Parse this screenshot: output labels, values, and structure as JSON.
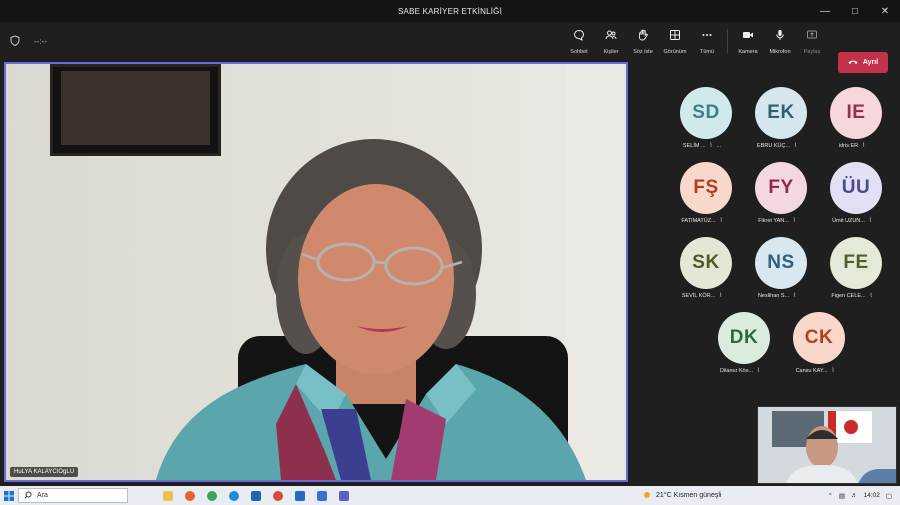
{
  "window": {
    "title": "SABE KARİYER ETKİNLİĞİ",
    "controls": [
      "minimize-icon",
      "maximize-icon",
      "close-icon"
    ]
  },
  "toolbar": {
    "timer": "--:--",
    "items": [
      {
        "label": "Sohbet",
        "icon": "chat-icon"
      },
      {
        "label": "Kişiler",
        "icon": "people-icon"
      },
      {
        "label": "Söz iste",
        "icon": "raise-hand-icon"
      },
      {
        "label": "Görünüm",
        "icon": "view-icon"
      },
      {
        "label": "Tümü",
        "icon": "more-icon"
      },
      {
        "label": "Kamera",
        "icon": "camera-icon"
      },
      {
        "label": "Mikrofon",
        "icon": "microphone-icon"
      },
      {
        "label": "Paylaş",
        "icon": "share-icon"
      }
    ],
    "leave_label": "Ayrıl",
    "leave_color": "#c4314b"
  },
  "main_video": {
    "speaker_name": "HuLYA KALAYCIOgLU",
    "active_border_color": "#6b69d6"
  },
  "participants": [
    {
      "initials": "SD",
      "name": "SELİM ...",
      "bg": "#cfe9ec",
      "fg": "#3d7f86",
      "more": "..."
    },
    {
      "initials": "EK",
      "name": "EBRU KÜÇ...",
      "bg": "#d5e6ef",
      "fg": "#2f5f73"
    },
    {
      "initials": "IE",
      "name": "idris ER",
      "bg": "#f5d7dc",
      "fg": "#9b2c4b"
    },
    {
      "initials": "FŞ",
      "name": "FATIMATÜZ...",
      "bg": "#f8d8cb",
      "fg": "#b23b22"
    },
    {
      "initials": "FY",
      "name": "Fikret YAN...",
      "bg": "#f3d9df",
      "fg": "#8f2a44"
    },
    {
      "initials": "ÜU",
      "name": "Ümit UZUN...",
      "bg": "#e3e0f3",
      "fg": "#4b4a8e"
    },
    {
      "initials": "SK",
      "name": "SEVİL KÖR...",
      "bg": "#e3e8d6",
      "fg": "#4a5a2a"
    },
    {
      "initials": "NS",
      "name": "Neslihan S...",
      "bg": "#d8e7f0",
      "fg": "#2f5f7c"
    },
    {
      "initials": "FE",
      "name": "Figen CELE...",
      "bg": "#e3ead8",
      "fg": "#4e5f2b"
    },
    {
      "initials": "DK",
      "name": "Dilanur Kös...",
      "bg": "#d9ecdd",
      "fg": "#2f6a3f"
    },
    {
      "initials": "CK",
      "name": "Cansu KAY...",
      "bg": "#f9d8cb",
      "fg": "#b73e22"
    }
  ],
  "taskbar": {
    "search_placeholder": "Ara",
    "weather": "21°C  Kısmen güneşli",
    "time": "14:02"
  }
}
